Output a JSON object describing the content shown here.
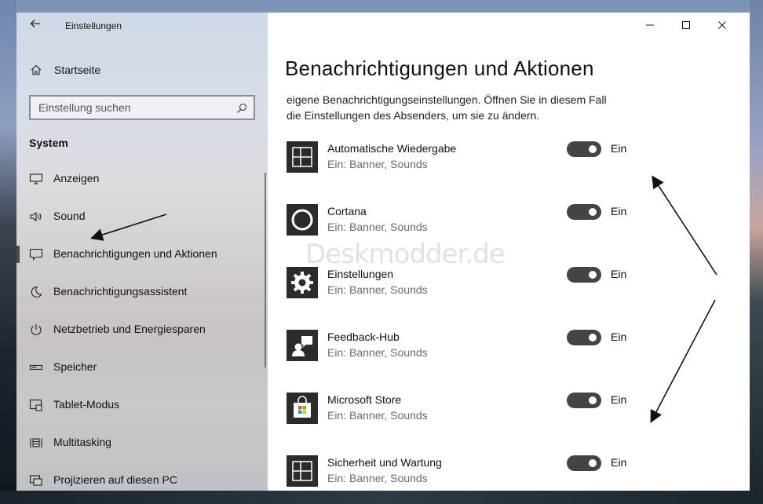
{
  "window": {
    "title": "Einstellungen"
  },
  "sidebar": {
    "home_label": "Startseite",
    "search_placeholder": "Einstellung suchen",
    "section_header": "System",
    "items": [
      {
        "label": "Anzeigen",
        "icon": "display-icon"
      },
      {
        "label": "Sound",
        "icon": "speaker-icon"
      },
      {
        "label": "Benachrichtigungen und Aktionen",
        "icon": "notification-icon",
        "selected": true
      },
      {
        "label": "Benachrichtigungsassistent",
        "icon": "moon-icon"
      },
      {
        "label": "Netzbetrieb und Energiesparen",
        "icon": "power-icon"
      },
      {
        "label": "Speicher",
        "icon": "storage-icon"
      },
      {
        "label": "Tablet-Modus",
        "icon": "tablet-icon"
      },
      {
        "label": "Multitasking",
        "icon": "multitasking-icon"
      },
      {
        "label": "Projizieren auf diesen PC",
        "icon": "project-icon"
      }
    ]
  },
  "main": {
    "page_title": "Benachrichtigungen und Aktionen",
    "description_line1": "eigene Benachrichtigungseinstellungen. Öffnen Sie in diesem Fall",
    "description_line2": "die Einstellungen des Absenders, um sie zu ändern.",
    "apps": [
      {
        "name": "Automatische Wiedergabe",
        "status": "Ein: Banner, Sounds",
        "toggle": "Ein",
        "icon": "autoplay-icon"
      },
      {
        "name": "Cortana",
        "status": "Ein: Banner, Sounds",
        "toggle": "Ein",
        "icon": "cortana-icon"
      },
      {
        "name": "Einstellungen",
        "status": "Ein: Banner, Sounds",
        "toggle": "Ein",
        "icon": "gear-icon"
      },
      {
        "name": "Feedback-Hub",
        "status": "Ein: Banner, Sounds",
        "toggle": "Ein",
        "icon": "feedback-hub-icon"
      },
      {
        "name": "Microsoft Store",
        "status": "Ein: Banner, Sounds",
        "toggle": "Ein",
        "icon": "store-icon"
      },
      {
        "name": "Sicherheit und Wartung",
        "status": "Ein: Banner, Sounds",
        "toggle": "Ein",
        "icon": "security-maintenance-icon"
      }
    ]
  },
  "watermark": "Deskmodder.de",
  "colors": {
    "toggle_on": "#444444",
    "tile_bg": "#2b2b2b"
  }
}
